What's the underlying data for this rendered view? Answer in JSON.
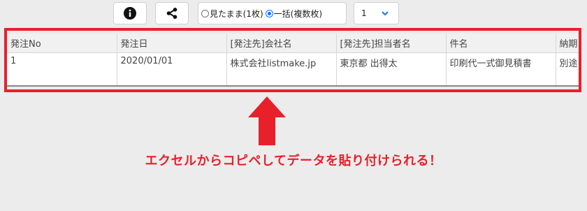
{
  "toolbar": {
    "info_icon": "info-icon",
    "share_icon": "share-icon",
    "radio_options": [
      {
        "label": "見たまま(1枚)",
        "checked": false
      },
      {
        "label": "一括(複数枚)",
        "checked": true
      }
    ],
    "page_select": {
      "value": "1"
    }
  },
  "table": {
    "headers": [
      "発注No",
      "発注日",
      "[発注先]会社名",
      "[発注先]担当者名",
      "件名",
      "納期"
    ],
    "rows": [
      [
        "1",
        "2020/01/01",
        "株式会社listmake.jp",
        "東京都 出得太",
        "印刷代一式御見積書",
        "別途ご"
      ]
    ]
  },
  "annotation": {
    "caption": "エクセルからコピペしてデータを貼り付けられる！",
    "accent_color": "#e8202a"
  }
}
